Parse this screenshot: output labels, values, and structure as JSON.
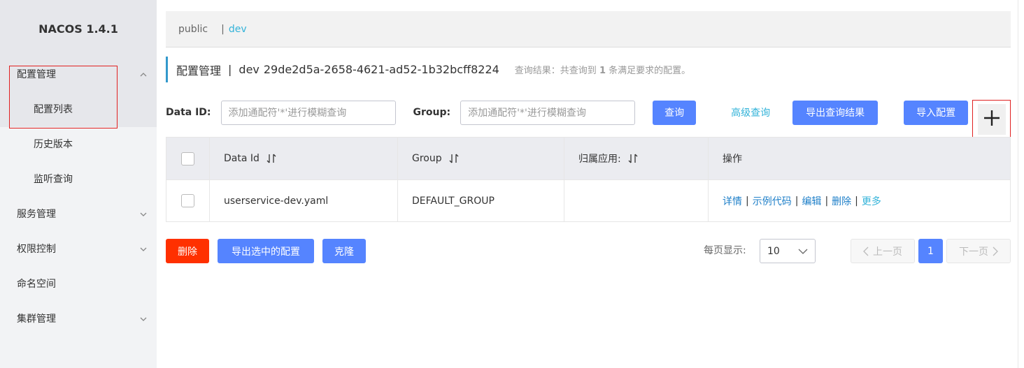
{
  "app": {
    "title": "NACOS 1.4.1"
  },
  "sidebar": {
    "items": [
      {
        "label": "配置管理",
        "expanded": true
      },
      {
        "label": "配置列表",
        "active": true
      },
      {
        "label": "历史版本"
      },
      {
        "label": "监听查询"
      },
      {
        "label": "服务管理"
      },
      {
        "label": "权限控制"
      },
      {
        "label": "命名空间"
      },
      {
        "label": "集群管理"
      }
    ]
  },
  "namespaces": {
    "public": "public",
    "separator": "|",
    "dev": "dev"
  },
  "header": {
    "title": "配置管理",
    "separator": "|",
    "namespace": "dev",
    "namespace_id": "29de2d5a-2658-4621-ad52-1b32bcff8224",
    "result_prefix": "查询结果：共查询到",
    "result_count": "1",
    "result_suffix": "条满足要求的配置。"
  },
  "search": {
    "dataid_label": "Data ID:",
    "dataid_placeholder": "添加通配符'*'进行模糊查询",
    "group_label": "Group:",
    "group_placeholder": "添加通配符'*'进行模糊查询",
    "query_button": "查询",
    "advanced_query": "高级查询",
    "export_results_button": "导出查询结果",
    "import_button": "导入配置",
    "add_icon": "plus-icon"
  },
  "table": {
    "headers": [
      "Data Id",
      "Group",
      "归属应用:",
      "操作"
    ],
    "rows": [
      {
        "data_id": "userservice-dev.yaml",
        "group": "DEFAULT_GROUP",
        "app": "",
        "actions": [
          "详情",
          "示例代码",
          "编辑",
          "删除",
          "更多"
        ],
        "action_sep": "|"
      }
    ]
  },
  "footer": {
    "delete_button": "删除",
    "export_selected_button": "导出选中的配置",
    "clone_button": "克隆",
    "page_size_label": "每页显示:",
    "page_size": "10",
    "prev_page": "上一页",
    "current_page": "1",
    "next_page": "下一页"
  },
  "colors": {
    "primary": "#5584ff",
    "danger": "#ff3000",
    "link": "#33b3d9",
    "highlight_box": "#e02020"
  }
}
